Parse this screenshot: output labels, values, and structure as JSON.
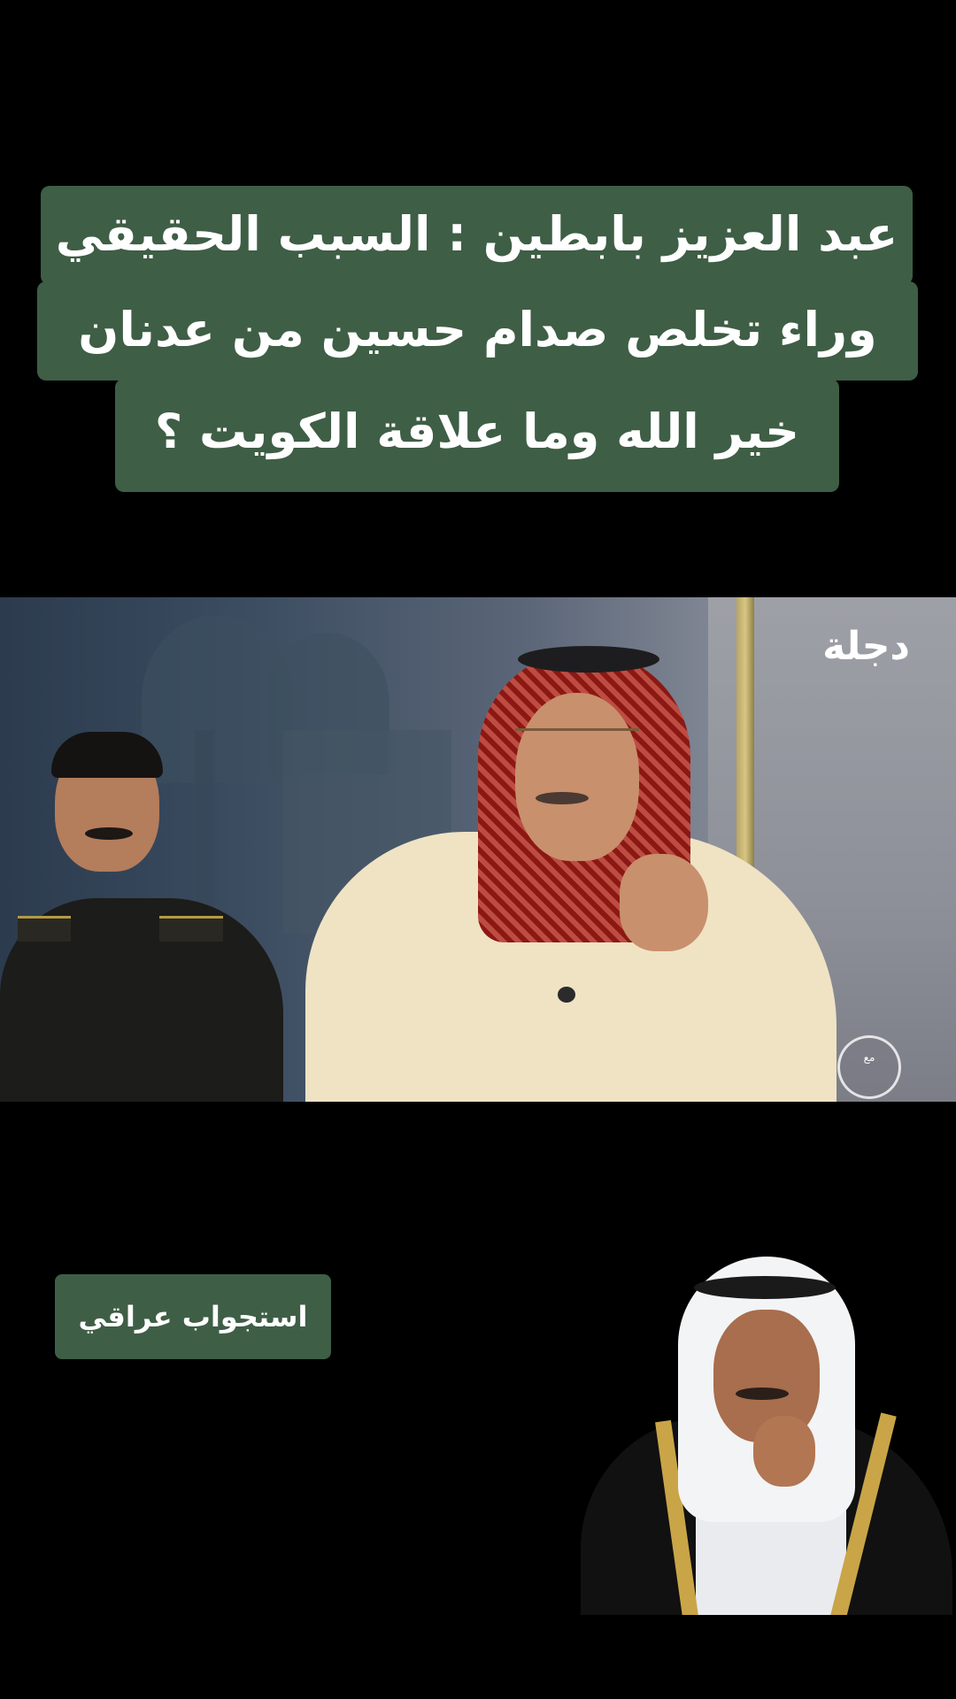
{
  "title": {
    "line1": "عبد العزيز بابطين : السبب الحقيقي",
    "line2": "وراء تخلص صدام حسين من عدنان",
    "line3": "خير الله وما علاقة الكويت ؟"
  },
  "video": {
    "channel_logo": "دجلة",
    "program_badge": "مع"
  },
  "label": {
    "text": "استجواب عراقي"
  },
  "colors": {
    "background": "#000000",
    "title_bar": "#3e5e45",
    "text": "#ffffff"
  }
}
